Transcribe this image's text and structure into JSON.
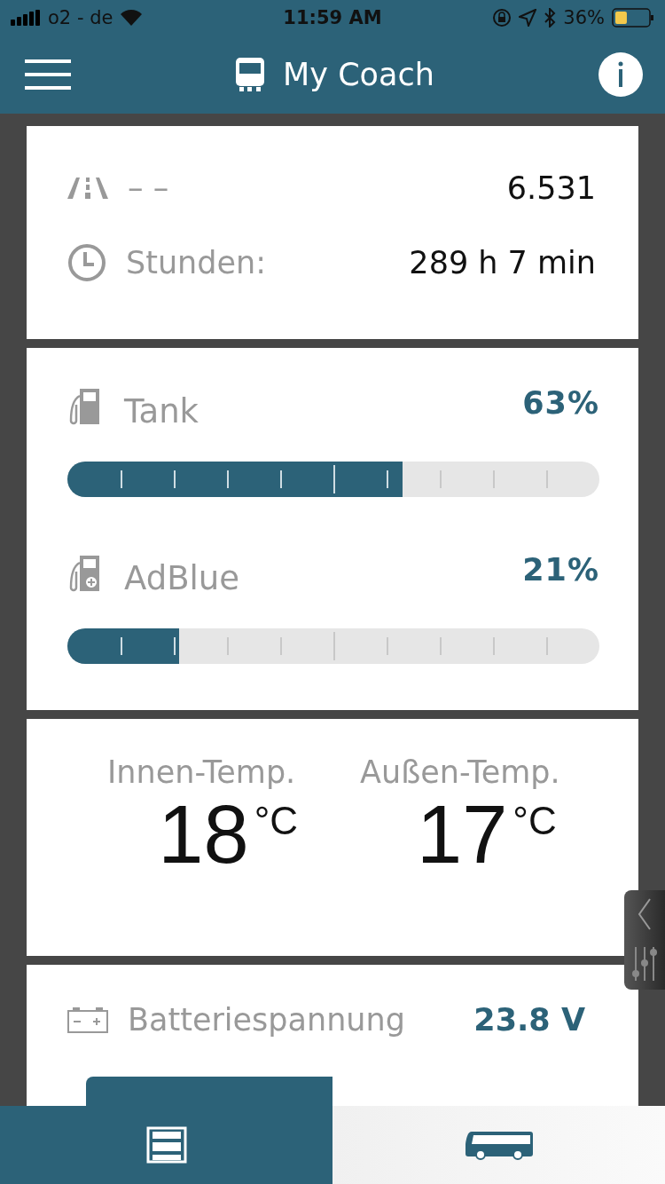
{
  "status_bar": {
    "carrier": "o2 - de",
    "time": "11:59 AM",
    "battery": "36%"
  },
  "header": {
    "title": "My Coach"
  },
  "odometer": {
    "label": "– –",
    "value": "6.531"
  },
  "hours": {
    "label": "Stunden:",
    "value": "289 h 7 min"
  },
  "levels": [
    {
      "kind": "fuel",
      "label": "Tank",
      "reading": "63%",
      "level": 0.63
    },
    {
      "kind": "adblue",
      "label": "AdBlue",
      "reading": "21%",
      "level": 0.21
    }
  ],
  "temperatures": [
    {
      "label": "Innen-Temp.",
      "value": "18",
      "unit": "°C"
    },
    {
      "label": "Außen-Temp.",
      "value": "17",
      "unit": "°C"
    }
  ],
  "battery_voltage": {
    "label": "Batteriespannung",
    "value": "23.8 V"
  },
  "tabs": [
    {
      "kind": "dashboard",
      "selected": true
    },
    {
      "kind": "coach",
      "selected": false
    }
  ]
}
